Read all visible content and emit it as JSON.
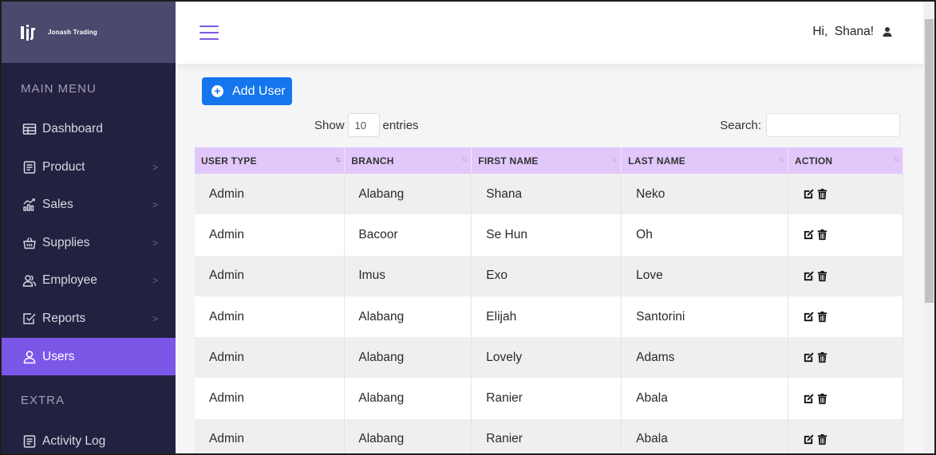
{
  "brand": {
    "name": "Jonash Trading"
  },
  "sidebar": {
    "main_menu_title": "MAIN MENU",
    "extra_title": "EXTRA",
    "items": [
      {
        "label": "Dashboard",
        "icon": "dashboard-icon"
      },
      {
        "label": "Product",
        "icon": "product-icon",
        "chevron": ">"
      },
      {
        "label": "Sales",
        "icon": "sales-chart-icon",
        "chevron": ">"
      },
      {
        "label": "Supplies",
        "icon": "basket-icon",
        "chevron": ">"
      },
      {
        "label": "Employee",
        "icon": "users-icon",
        "chevron": ">"
      },
      {
        "label": "Reports",
        "icon": "checkbox-icon",
        "chevron": ">"
      },
      {
        "label": "Users",
        "icon": "user-icon",
        "active": true
      },
      {
        "label": "Activity Log",
        "icon": "document-icon"
      }
    ]
  },
  "topbar": {
    "greeting": "Hi,  Shana!"
  },
  "toolbar": {
    "add_user_label": "Add User",
    "show_label": "Show",
    "entries_value": "10",
    "entries_label": "entries",
    "search_label": "Search:",
    "search_value": ""
  },
  "table": {
    "columns": [
      "USER TYPE",
      "BRANCH",
      "FIRST NAME",
      "LAST NAME",
      "ACTION"
    ],
    "rows": [
      [
        "Admin",
        "Alabang",
        "Shana",
        "Neko"
      ],
      [
        "Admin",
        "Bacoor",
        "Se Hun",
        "Oh"
      ],
      [
        "Admin",
        "Imus",
        "Exo",
        "Love"
      ],
      [
        "Admin",
        "Alabang",
        "Elijah",
        "Santorini"
      ],
      [
        "Admin",
        "Alabang",
        "Lovely",
        "Adams"
      ],
      [
        "Admin",
        "Alabang",
        "Ranier",
        "Abala"
      ],
      [
        "Admin",
        "Alabang",
        "Ranier",
        "Abala"
      ]
    ]
  },
  "colors": {
    "sidebar_bg": "#222240",
    "brand_bg": "#4a4a6e",
    "accent": "#7b57e8",
    "primary_button": "#1476ec",
    "table_header": "#e2c8fa"
  }
}
